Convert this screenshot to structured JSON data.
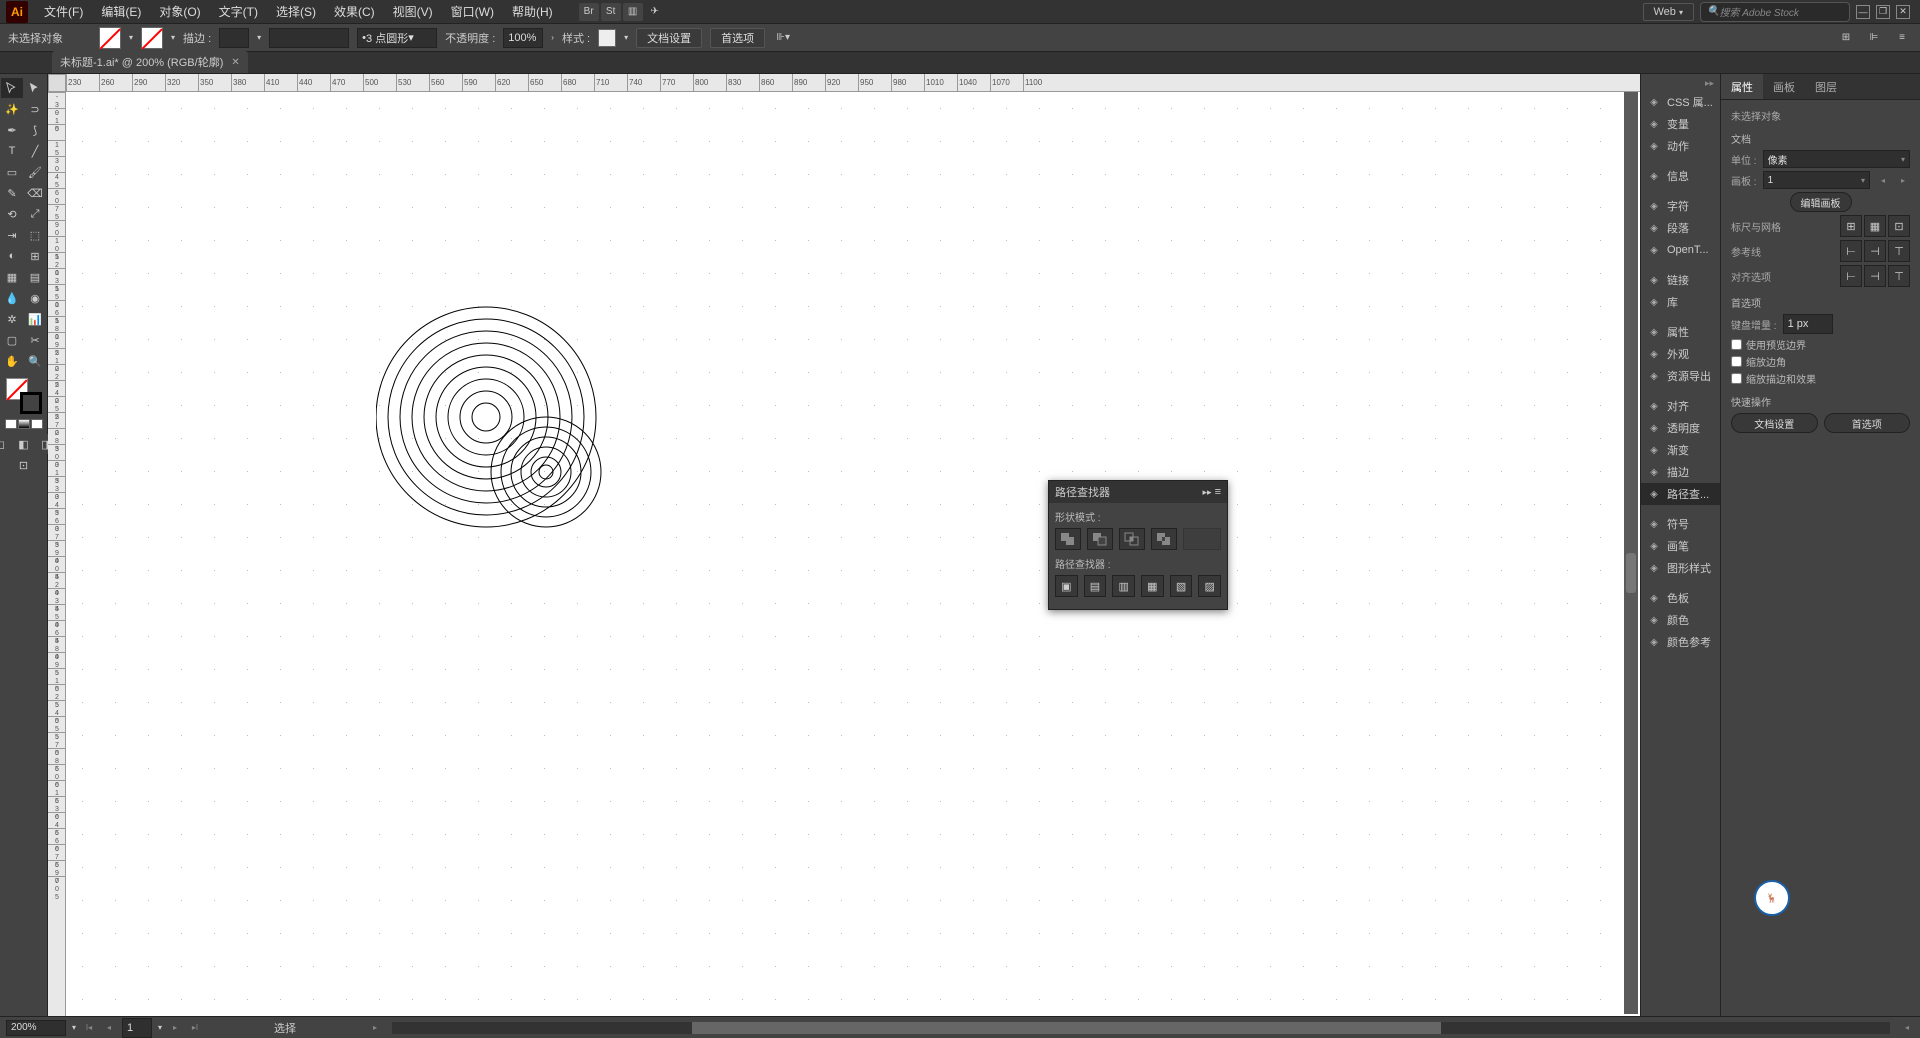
{
  "app": {
    "name": "Ai"
  },
  "menu": [
    "文件(F)",
    "编辑(E)",
    "对象(O)",
    "文字(T)",
    "选择(S)",
    "效果(C)",
    "视图(V)",
    "窗口(W)",
    "帮助(H)"
  ],
  "topIcons": [
    "Br",
    "St"
  ],
  "workspace": "Web",
  "searchPlaceholder": "搜索 Adobe Stock",
  "control": {
    "noSelection": "未选择对象",
    "strokeLabel": "描边 :",
    "strokeValue": "",
    "profile": "3 点圆形",
    "opacityLabel": "不透明度 :",
    "opacityValue": "100%",
    "styleLabel": "样式 :",
    "docSetup": "文档设置",
    "prefs": "首选项"
  },
  "docTab": "未标题-1.ai* @ 200% (RGB/轮廓)",
  "rulerStart": 230,
  "rulerStep": 30,
  "rulerVStep": 15,
  "dockItems": [
    {
      "icon": "css",
      "label": "CSS 属..."
    },
    {
      "icon": "var",
      "label": "变量"
    },
    {
      "icon": "act",
      "label": "动作"
    },
    {
      "sep": true
    },
    {
      "icon": "info",
      "label": "信息"
    },
    {
      "sep": true
    },
    {
      "icon": "A",
      "label": "字符"
    },
    {
      "icon": "¶",
      "label": "段落"
    },
    {
      "icon": "O",
      "label": "OpenT..."
    },
    {
      "sep": true
    },
    {
      "icon": "link",
      "label": "链接"
    },
    {
      "icon": "lib",
      "label": "库"
    },
    {
      "sep": true
    },
    {
      "icon": "prop",
      "label": "属性"
    },
    {
      "icon": "app",
      "label": "外观"
    },
    {
      "icon": "exp",
      "label": "资源导出"
    },
    {
      "sep": true
    },
    {
      "icon": "ali",
      "label": "对齐"
    },
    {
      "icon": "tra",
      "label": "透明度"
    },
    {
      "icon": "grd",
      "label": "渐变"
    },
    {
      "icon": "str",
      "label": "描边"
    },
    {
      "icon": "pf",
      "label": "路径查...",
      "active": true
    },
    {
      "sep": true
    },
    {
      "icon": "sym",
      "label": "符号"
    },
    {
      "icon": "brs",
      "label": "画笔"
    },
    {
      "icon": "gst",
      "label": "图形样式"
    },
    {
      "sep": true
    },
    {
      "icon": "swa",
      "label": "色板"
    },
    {
      "icon": "col",
      "label": "颜色"
    },
    {
      "icon": "cgd",
      "label": "颜色参考"
    }
  ],
  "propTabs": [
    "属性",
    "画板",
    "图层"
  ],
  "prop": {
    "noSel": "未选择对象",
    "doc": "文档",
    "unitLabel": "单位 :",
    "unitValue": "像素",
    "artboardLabel": "画板 :",
    "artboardValue": "1",
    "editArtboard": "编辑画板",
    "ruler": "标尺与网格",
    "guides": "参考线",
    "alignOpt": "对齐选项",
    "prefs": "首选项",
    "keyIncLabel": "键盘增量 :",
    "keyIncValue": "1 px",
    "chk1": "使用预览边界",
    "chk2": "缩放边角",
    "chk3": "缩放描边和效果",
    "quick": "快速操作",
    "docSetup": "文档设置",
    "prefBtn": "首选项"
  },
  "pathfinder": {
    "title": "路径查找器",
    "shapeMode": "形状模式 :",
    "pfLabel": "路径查找器 :"
  },
  "status": {
    "zoom": "200%",
    "artboard": "1",
    "tool": "选择"
  }
}
